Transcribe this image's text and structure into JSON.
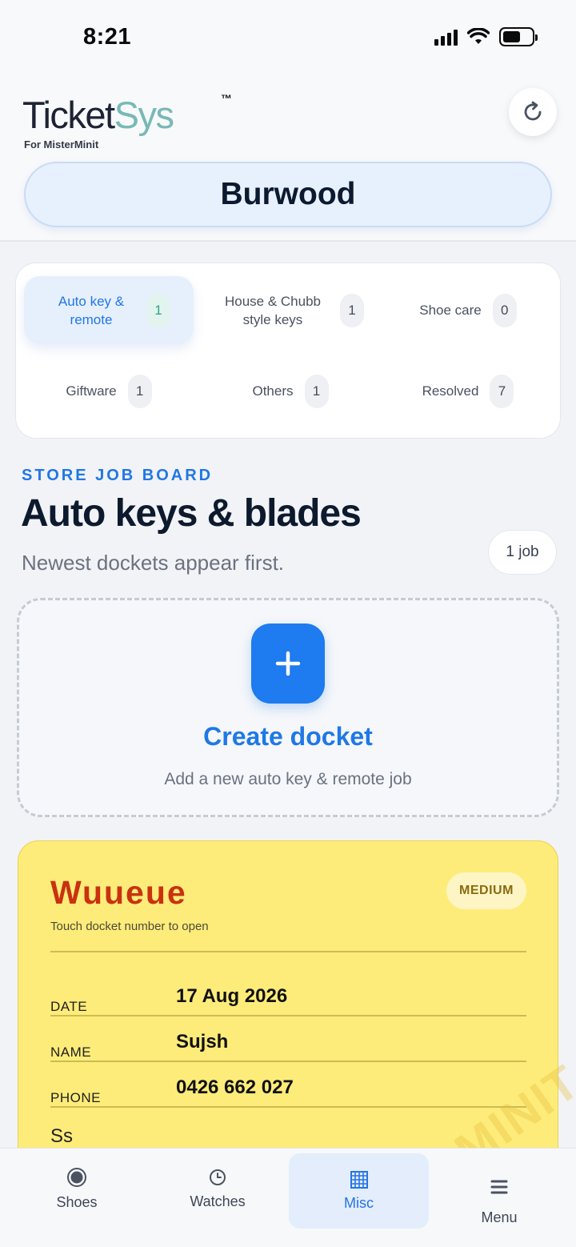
{
  "status_bar": {
    "time": "8:21"
  },
  "header": {
    "logo_ticket": "Ticket",
    "logo_sys": "Sys",
    "trademark": "™",
    "logo_sub": "For MisterMinit",
    "store_name": "Burwood",
    "refresh_icon": "refresh-icon"
  },
  "categories": [
    {
      "label": "Auto key & remote",
      "count": "1",
      "active": true
    },
    {
      "label": "House & Chubb style keys",
      "count": "1",
      "active": false
    },
    {
      "label": "Shoe care",
      "count": "0",
      "active": false
    },
    {
      "label": "Giftware",
      "count": "1",
      "active": false
    },
    {
      "label": "Others",
      "count": "1",
      "active": false
    },
    {
      "label": "Resolved",
      "count": "7",
      "active": false
    }
  ],
  "board": {
    "eyebrow": "STORE JOB BOARD",
    "title": "Auto keys & blades",
    "subtitle": "Newest dockets appear first.",
    "job_count": "1 job"
  },
  "create": {
    "title": "Create docket",
    "subtitle": "Add a new auto key & remote job"
  },
  "docket": {
    "number": "Wuueue",
    "hint": "Touch docket number to open",
    "priority": "MEDIUM",
    "date_label": "DATE",
    "date_value": "17 Aug 2026",
    "name_label": "NAME",
    "name_value": "Sujsh",
    "phone_label": "PHONE",
    "phone_value": "0426 662 027",
    "notes": "Ss",
    "watermark": "MINIT",
    "color": "#fdec79"
  },
  "nav": [
    {
      "label": "Shoes",
      "icon": "shoe-icon",
      "active": false
    },
    {
      "label": "Watches",
      "icon": "clock-icon",
      "active": false
    },
    {
      "label": "Misc",
      "icon": "grid-icon",
      "active": true
    },
    {
      "label": "Menu",
      "icon": "menu-icon",
      "active": false
    }
  ],
  "colors": {
    "accent": "#1e7bf0",
    "docket_number": "#c9310f"
  }
}
